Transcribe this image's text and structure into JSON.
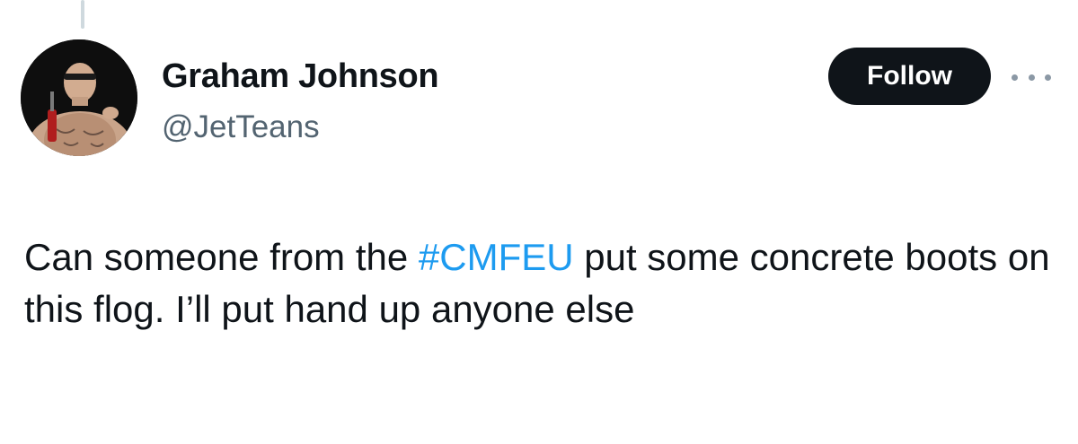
{
  "author": {
    "name": "Graham Johnson",
    "handle": "@JetTeans"
  },
  "header": {
    "follow_label": "Follow"
  },
  "icons": {
    "more": "more-horizontal-icon",
    "avatar": "profile-avatar"
  },
  "tweet": {
    "text_before": "Can someone from the ",
    "hashtag": "#CMFEU",
    "text_after": " put some concrete boots on this flog. I’ll put hand up anyone else"
  },
  "colors": {
    "text": "#0f1419",
    "secondary": "#536471",
    "link": "#1d9bf0",
    "follow_bg": "#0f1419",
    "follow_text": "#ffffff"
  }
}
